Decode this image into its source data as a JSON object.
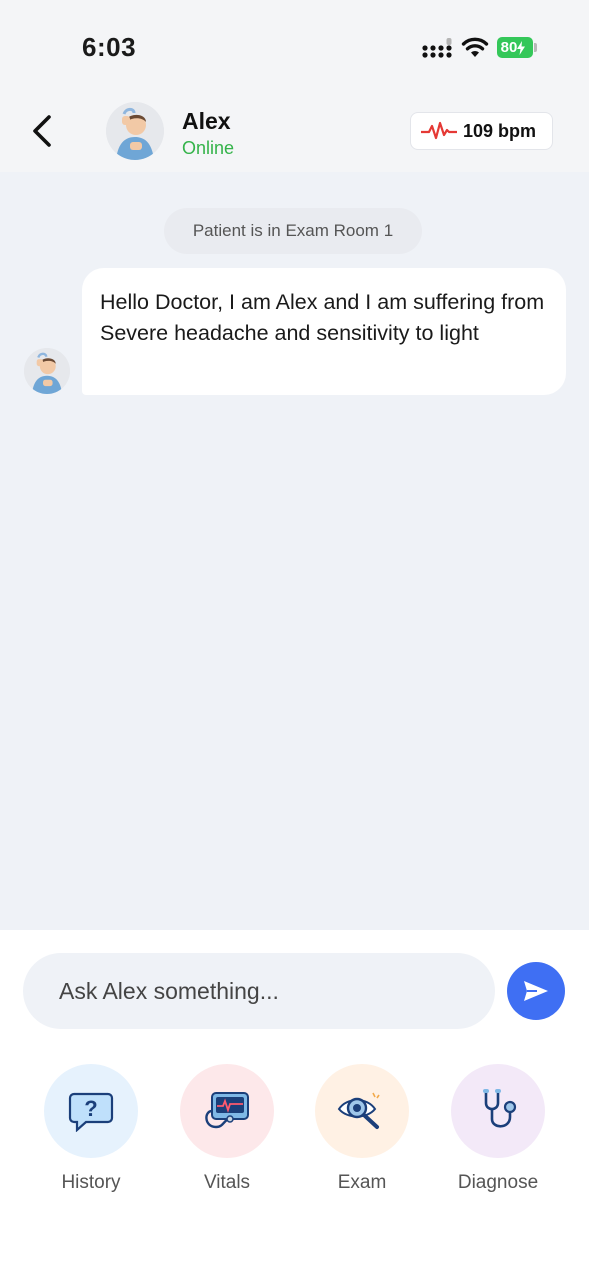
{
  "status_bar": {
    "time": "6:03",
    "battery": "80",
    "icons": [
      "cellular-signal-icon",
      "wifi-icon",
      "battery-charging-icon"
    ]
  },
  "header": {
    "back_icon": "chevron-left-icon",
    "contact_name": "Alex",
    "contact_status": "Online",
    "heart_rate": "109 bpm",
    "heart_icon": "heartbeat-icon"
  },
  "chat": {
    "system_message": "Patient is in Exam Room 1",
    "messages": [
      {
        "sender": "Alex",
        "text": "Hello Doctor, I am Alex and I am suffering from Severe headache and sensitivity to light"
      }
    ]
  },
  "composer": {
    "placeholder": "Ask Alex something...",
    "send_icon": "send-icon"
  },
  "actions": [
    {
      "label": "History",
      "icon": "question-bubble-icon",
      "color": "#e6f2fd"
    },
    {
      "label": "Vitals",
      "icon": "vitals-monitor-icon",
      "color": "#fde8ea"
    },
    {
      "label": "Exam",
      "icon": "eye-magnifier-icon",
      "color": "#fff1e4"
    },
    {
      "label": "Diagnose",
      "icon": "stethoscope-icon",
      "color": "#f3e9f8"
    }
  ],
  "colors": {
    "accent": "#3f6ff3",
    "online": "#34b34a",
    "heart": "#e53935",
    "battery": "#34c759"
  }
}
